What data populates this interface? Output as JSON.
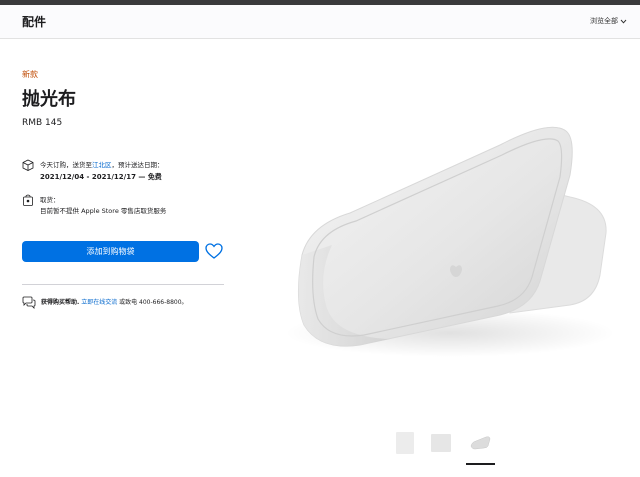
{
  "header": {
    "title": "配件",
    "browse_all": "浏览全部"
  },
  "product": {
    "badge": "新款",
    "title": "抛光布",
    "price": "RMB 145"
  },
  "delivery": {
    "prefix": "今天订购，送货至",
    "location": "江北区",
    "suffix": "，预计送达日期：",
    "dates": "2021/12/04 - 2021/12/17",
    "dash": " — ",
    "cost": "免费"
  },
  "pickup": {
    "label": "取货：",
    "note": "目前暂不提供 Apple Store 零售店取货服务"
  },
  "actions": {
    "add_to_bag": "添加到购物袋"
  },
  "help": {
    "prefix": "获得购买帮助.",
    "chat_link": "立即在线交流",
    "phone_text": " 或致电 400-666-8800。"
  },
  "thumbnails": [
    {
      "name": "thumbnail-1"
    },
    {
      "name": "thumbnail-2"
    },
    {
      "name": "thumbnail-3",
      "selected": true
    }
  ],
  "colors": {
    "accent": "#0071e3",
    "link": "#0066cc",
    "badge": "#bf4800"
  }
}
